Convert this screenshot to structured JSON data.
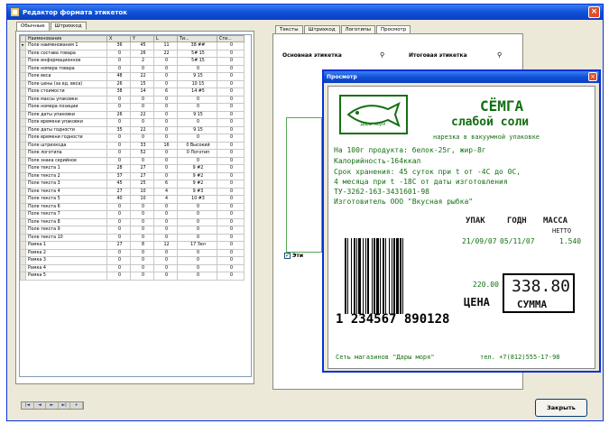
{
  "window": {
    "title": "Редактор формата этикеток"
  },
  "left_tabs": [
    "Обычные",
    "Штрихкод"
  ],
  "grid": {
    "headers": [
      "Наименование",
      "X",
      "Y",
      "L",
      "Ти...",
      "Сти..."
    ],
    "rows": [
      [
        "Поле наименования 1",
        "36",
        "45",
        "11",
        "38 ##",
        "0"
      ],
      [
        "Поле состава товара",
        "0",
        "26",
        "22",
        "5# 15",
        "0"
      ],
      [
        "Поле информационное",
        "0",
        "2",
        "0",
        "5# 15",
        "0"
      ],
      [
        "Поле номера товара",
        "0",
        "0",
        "0",
        "0",
        "0"
      ],
      [
        "Поле веса",
        "48",
        "22",
        "0",
        "9 15",
        "0"
      ],
      [
        "Поле цены (за ед. веса)",
        "26",
        "15",
        "0",
        "10 15",
        "0"
      ],
      [
        "Поле стоимости",
        "38",
        "14",
        "6",
        "14 #5",
        "0"
      ],
      [
        "Поле массы упаковки",
        "0",
        "0",
        "0",
        "0",
        "0"
      ],
      [
        "Поле номера позиции",
        "0",
        "0",
        "0",
        "0",
        "0"
      ],
      [
        "Поле даты упаковки",
        "26",
        "22",
        "0",
        "9 15",
        "0"
      ],
      [
        "Поле времени упаковки",
        "0",
        "0",
        "0",
        "0",
        "0"
      ],
      [
        "Поле даты годности",
        "35",
        "22",
        "0",
        "9 15",
        "0"
      ],
      [
        "Поле времени годности",
        "0",
        "0",
        "0",
        "0",
        "0"
      ],
      [
        "Поле штрихкода",
        "0",
        "33",
        "16",
        "0 Высокий",
        "0"
      ],
      [
        "Поле логотипа",
        "0",
        "52",
        "0",
        "0 Логотип",
        "0"
      ],
      [
        "Поле знака серийное",
        "0",
        "0",
        "0",
        "0",
        "0"
      ],
      [
        "Поле текста 1",
        "28",
        "27",
        "0",
        "9 #2",
        "0"
      ],
      [
        "Поле текста 2",
        "37",
        "27",
        "0",
        "9 #2",
        "0"
      ],
      [
        "Поле текста 3",
        "45",
        "25",
        "6",
        "9 #2",
        "0"
      ],
      [
        "Поле текста 4",
        "27",
        "10",
        "4",
        "9 #3",
        "0"
      ],
      [
        "Поле текста 5",
        "40",
        "10",
        "4",
        "10 #3",
        "0"
      ],
      [
        "Поле текста 6",
        "0",
        "0",
        "0",
        "0",
        "0"
      ],
      [
        "Поле текста 7",
        "0",
        "0",
        "0",
        "0",
        "0"
      ],
      [
        "Поле текста 8",
        "0",
        "0",
        "0",
        "0",
        "0"
      ],
      [
        "Поле текста 9",
        "0",
        "0",
        "0",
        "0",
        "0"
      ],
      [
        "Поле текста 10",
        "0",
        "0",
        "0",
        "0",
        "0"
      ],
      [
        "Рамка 1",
        "27",
        "8",
        "12",
        "17 Зел",
        "0"
      ],
      [
        "Рамка 2",
        "0",
        "0",
        "0",
        "0",
        "0"
      ],
      [
        "Рамка 3",
        "0",
        "0",
        "0",
        "0",
        "0"
      ],
      [
        "Рамка 4",
        "0",
        "0",
        "0",
        "0",
        "0"
      ],
      [
        "Рамка 5",
        "0",
        "0",
        "0",
        "0",
        "0"
      ]
    ]
  },
  "right_tabs": [
    "Тексты",
    "Штрихкод",
    "Логотипы",
    "Просмотр"
  ],
  "right_headers": {
    "main": "Основная этикетка",
    "total": "Итоговая этикетка"
  },
  "checkbox_label": "Эти",
  "close_button": "Закрыть",
  "preview": {
    "title": "Просмотр",
    "product": "СЁМГА",
    "subtitle": "слабой соли",
    "packaging": "нарезка в вакуумной упаковке",
    "nutrition": "На 100г продукта: белок-25г, жир-8г",
    "calories": "Калорийность-164ккал",
    "storage": "Срок хранения: 45 суток при t от -4С до 0С,",
    "storage2": "4 месяца при t -18С от даты изготовления",
    "ty": "ТУ-3262-163-3431601-98",
    "maker": "Изготовитель ООО \"Вкусная рыбка\"",
    "col_pack": "УПАК",
    "col_good": "ГОДН",
    "col_mass": "МАССА",
    "col_netto": "НЕТТО",
    "date_pack": "21/09/07",
    "date_good": "05/11/07",
    "mass": "1.540",
    "price": "220.00",
    "price_label": "ЦЕНА",
    "sum": "338.80",
    "sum_label": "СУММА",
    "barcode_digits": "1 234567 890128",
    "store": "Сеть магазинов \"Дары моря\"",
    "phone": "тел. +7(812)555-17-98",
    "logo_text": "Дары моря"
  }
}
